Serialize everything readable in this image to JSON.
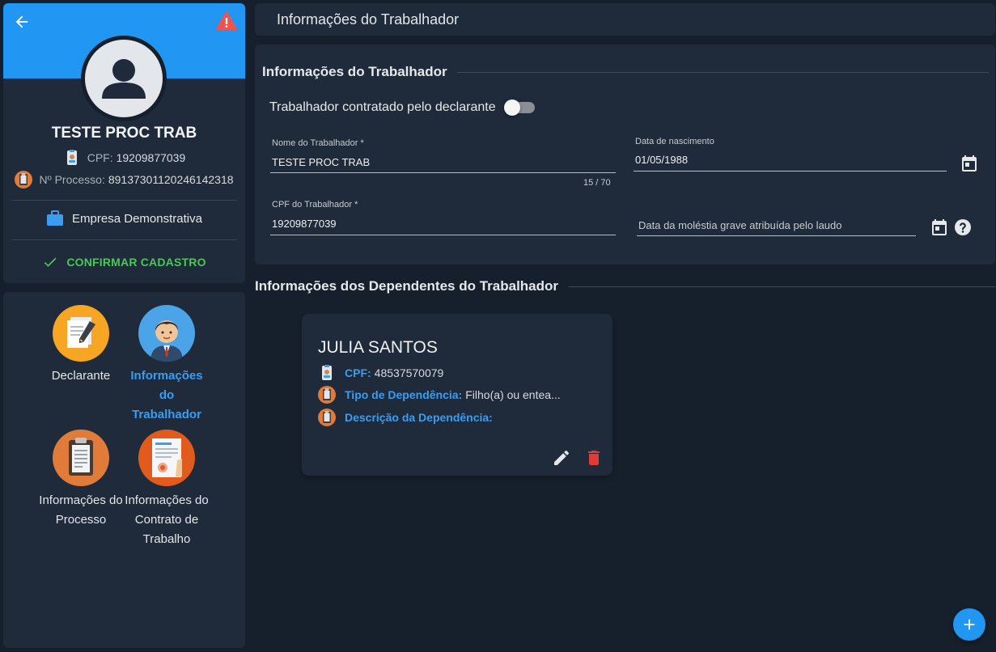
{
  "profile": {
    "name": "TESTE PROC TRAB",
    "cpf_label": "CPF:",
    "cpf_value": "19209877039",
    "processo_label": "Nº Processo:",
    "processo_value": "89137301120246142318",
    "company": "Empresa Demonstrativa",
    "confirm_label": "CONFIRMAR CADASTRO"
  },
  "nav": {
    "items": [
      {
        "label": "Declarante",
        "icon": "document-pen-icon",
        "active": false
      },
      {
        "label": "Informações do Trabalhador",
        "icon": "worker-avatar-icon",
        "active": true
      },
      {
        "label": "Informações do Processo",
        "icon": "clipboard-icon",
        "active": false
      },
      {
        "label": "Informações do Contrato de Trabalho",
        "icon": "contract-icon",
        "active": false
      }
    ]
  },
  "header": {
    "title": "Informações do Trabalhador"
  },
  "form": {
    "section_title": "Informações do Trabalhador",
    "toggle_label": "Trabalhador contratado pelo declarante",
    "toggle_on": false,
    "nome_label": "Nome do Trabalhador *",
    "nome_value": "TESTE PROC TRAB",
    "nome_counter": "15 / 70",
    "nascimento_label": "Data de nascimento",
    "nascimento_value": "01/05/1988",
    "cpf_label": "CPF do Trabalhador *",
    "cpf_value": "19209877039",
    "molestia_placeholder": "Data da moléstia grave atribuída pelo laudo"
  },
  "dependents": {
    "section_title": "Informações dos Dependentes do Trabalhador",
    "items": [
      {
        "name": "JULIA SANTOS",
        "cpf_label": "CPF:",
        "cpf_value": "48537570079",
        "tipo_label": "Tipo de Dependência:",
        "tipo_value": "Filho(a) ou entea...",
        "descricao_label": "Descrição da Dependência:",
        "descricao_value": ""
      }
    ]
  },
  "colors": {
    "banner": "#2196f3",
    "accent": "#3c9cf0",
    "confirm": "#4cc65a",
    "delete": "#e53935",
    "card": "#1f2b3a",
    "background": "#16202d"
  }
}
